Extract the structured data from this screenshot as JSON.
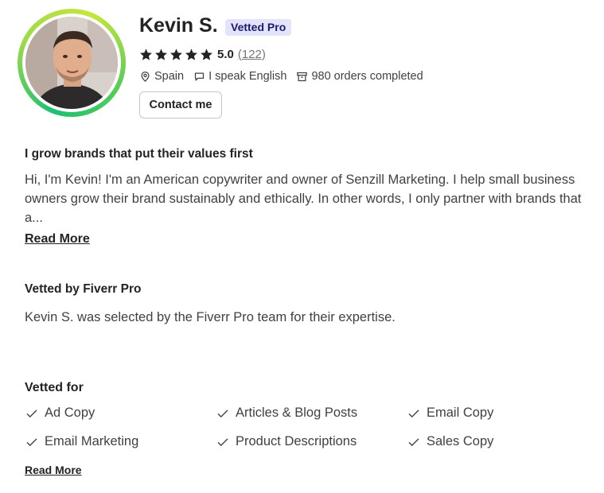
{
  "profile": {
    "name": "Kevin S.",
    "badge": "Vetted Pro",
    "rating": "5.0",
    "review_count": "(122)",
    "location": "Spain",
    "language": "I speak English",
    "orders": "980 orders completed",
    "contact_label": "Contact me"
  },
  "about": {
    "headline": "I grow brands that put their values first",
    "bio": "Hi, I'm Kevin! I'm an American copywriter and owner of Senzill Marketing. I help small business owners grow their brand sustainably and ethically. In other words, I only partner with brands that a...",
    "read_more": "Read More"
  },
  "vetted": {
    "title": "Vetted by Fiverr Pro",
    "text": "Kevin S. was selected by the Fiverr Pro team for their expertise."
  },
  "vetted_for": {
    "title": "Vetted for",
    "skills": [
      "Ad Copy",
      "Articles & Blog Posts",
      "Email Copy",
      "Email Marketing",
      "Product Descriptions",
      "Sales Copy"
    ],
    "read_more": "Read More"
  },
  "colors": {
    "accent": "#1dbf73",
    "badge_bg": "#e3e3fb",
    "badge_text": "#1e1a6f"
  },
  "icons": [
    "star-icon",
    "location-pin-icon",
    "chat-bubble-icon",
    "archive-box-icon",
    "checkmark-icon"
  ]
}
